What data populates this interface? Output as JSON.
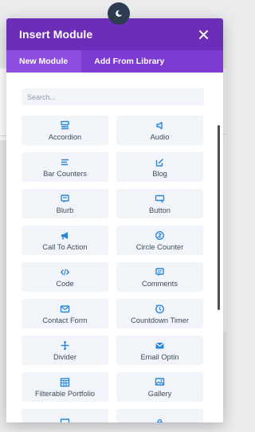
{
  "modal": {
    "title": "Insert Module",
    "close_icon": "close-icon"
  },
  "tabs": [
    {
      "label": "New Module",
      "active": true
    },
    {
      "label": "Add From Library",
      "active": false
    }
  ],
  "search": {
    "placeholder": "Search...",
    "value": ""
  },
  "modules": [
    {
      "label": "Accordion",
      "icon": "accordion-icon"
    },
    {
      "label": "Audio",
      "icon": "audio-icon"
    },
    {
      "label": "Bar Counters",
      "icon": "bar-counters-icon"
    },
    {
      "label": "Blog",
      "icon": "blog-icon"
    },
    {
      "label": "Blurb",
      "icon": "blurb-icon"
    },
    {
      "label": "Button",
      "icon": "button-icon"
    },
    {
      "label": "Call To Action",
      "icon": "call-to-action-icon"
    },
    {
      "label": "Circle Counter",
      "icon": "circle-counter-icon"
    },
    {
      "label": "Code",
      "icon": "code-icon"
    },
    {
      "label": "Comments",
      "icon": "comments-icon"
    },
    {
      "label": "Contact Form",
      "icon": "contact-form-icon"
    },
    {
      "label": "Countdown Timer",
      "icon": "countdown-timer-icon"
    },
    {
      "label": "Divider",
      "icon": "divider-icon"
    },
    {
      "label": "Email Optin",
      "icon": "email-optin-icon"
    },
    {
      "label": "Filterable Portfolio",
      "icon": "filterable-portfolio-icon"
    },
    {
      "label": "Gallery",
      "icon": "gallery-icon"
    },
    {
      "label": "",
      "icon": "image-icon"
    },
    {
      "label": "",
      "icon": "login-icon"
    }
  ],
  "colors": {
    "header": "#6c2eb9",
    "tabs_bar": "#7d3bd1",
    "active_tab": "#8e4ee0",
    "icon": "#2b87da",
    "tile_bg": "#f1f5f9",
    "label_text": "#3e4c5a"
  }
}
